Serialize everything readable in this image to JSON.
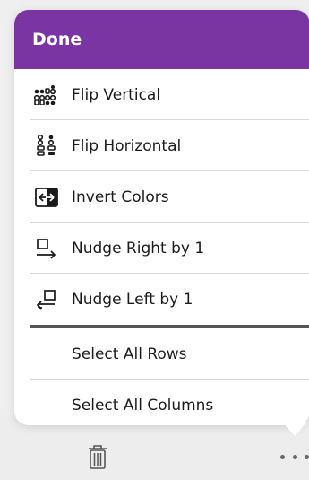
{
  "popover": {
    "header_title": "Done",
    "accent_color": "#7b35a3",
    "items": [
      {
        "label": "Flip Vertical",
        "icon": "flip-vertical-icon"
      },
      {
        "label": "Flip Horizontal",
        "icon": "flip-horizontal-icon"
      },
      {
        "label": "Invert Colors",
        "icon": "invert-colors-icon"
      },
      {
        "label": "Nudge Right by 1",
        "icon": "nudge-right-icon"
      },
      {
        "label": "Nudge Left by 1",
        "icon": "nudge-left-icon"
      }
    ],
    "select_items": [
      {
        "label": "Select All Rows"
      },
      {
        "label": "Select All Columns"
      }
    ]
  },
  "toolbar": {
    "trash_icon": "trash-icon",
    "more_icon": "more-icon"
  }
}
